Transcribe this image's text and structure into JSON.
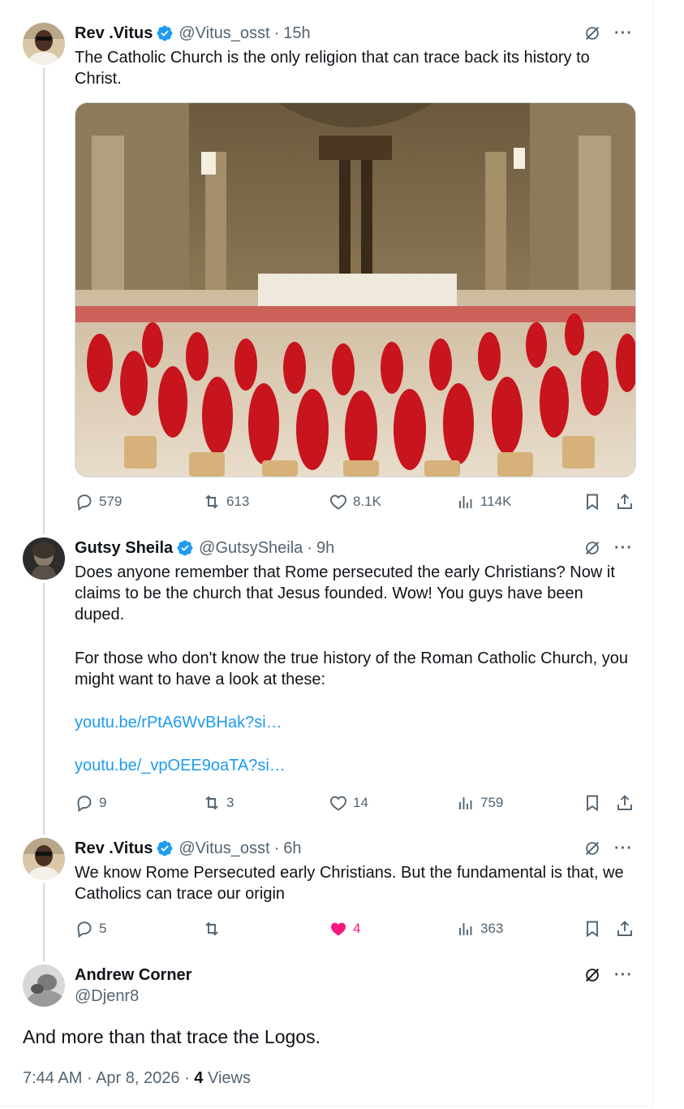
{
  "tweets": [
    {
      "name": "Rev .Vitus",
      "handle": "@Vitus_osst",
      "time": "15h",
      "text": "The Catholic Church is the only religion that can trace back its history to Christ.",
      "stats": {
        "replies": "579",
        "reposts": "613",
        "likes": "8.1K",
        "views": "114K"
      }
    },
    {
      "name": "Gutsy Sheila",
      "handle": "@GutsySheila",
      "time": "9h",
      "text_p1": "Does anyone remember that Rome persecuted the early Christians? Now it claims to be the church that Jesus founded. Wow! You guys have been duped.",
      "text_p2": "For those who don't know the true history of the Roman Catholic Church, you might want to have a look at these:",
      "link1": "youtu.be/rPtA6WvBHak?si…",
      "link2": "youtu.be/_vpOEE9oaTA?si…",
      "stats": {
        "replies": "9",
        "reposts": "3",
        "likes": "14",
        "views": "759"
      }
    },
    {
      "name": "Rev .Vitus",
      "handle": "@Vitus_osst",
      "time": "6h",
      "text": "We know Rome Persecuted early Christians. But the fundamental is that, we Catholics can trace our origin",
      "stats": {
        "replies": "5",
        "reposts": "",
        "likes": "4",
        "views": "363"
      },
      "liked": true
    }
  ],
  "main": {
    "name": "Andrew Corner",
    "handle": "@Djenr8",
    "text": "And more than that trace the Logos.",
    "time": "7:44 AM",
    "date": "Apr 8, 2026",
    "views_count": "4",
    "views_label": "Views"
  },
  "colors": {
    "accent": "#1d9bf0",
    "like": "#f91880",
    "muted": "#536471",
    "text": "#0f1419"
  }
}
